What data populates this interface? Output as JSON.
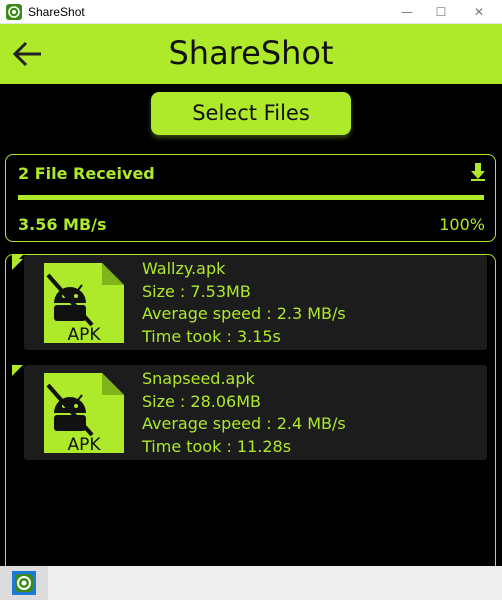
{
  "window": {
    "title": "ShareShot",
    "minimize_glyph": "—",
    "maximize_glyph": "☐",
    "close_glyph": "✕"
  },
  "header": {
    "title": "ShareShot",
    "back_icon": "arrow-left-icon"
  },
  "select_button": {
    "label": "Select Files"
  },
  "transfer": {
    "status": "2 File Received",
    "speed": "3.56 MB/s",
    "percent": "100%",
    "progress": 1.0,
    "download_icon": "download-arrow-icon"
  },
  "files": [
    {
      "name": "Wallzy.apk",
      "size": "Size : 7.53MB",
      "avg_speed": "Average speed : 2.3 MB/s",
      "time": "Time took : 3.15s",
      "icon_label": "APK"
    },
    {
      "name": "Snapseed.apk",
      "size": "Size : 28.06MB",
      "avg_speed": "Average speed : 2.4 MB/s",
      "time": "Time took : 11.28s",
      "icon_label": "APK"
    }
  ],
  "colors": {
    "accent": "#aeea2a",
    "background": "#000000",
    "card": "#1c1c1c"
  }
}
